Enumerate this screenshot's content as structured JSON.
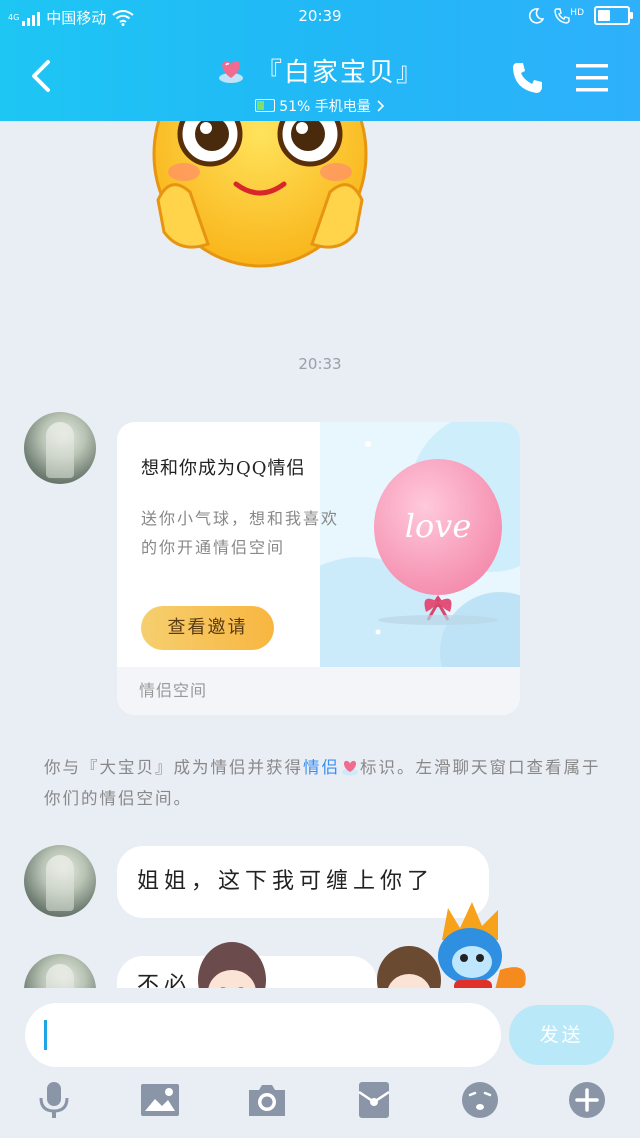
{
  "status_bar": {
    "network_type": "4G",
    "carrier": "中国移动",
    "time": "20:39",
    "call_label": "HD"
  },
  "header": {
    "title": "『白家宝贝』",
    "battery_text": "51% 手机电量",
    "battery_level_percent": 51,
    "gradient_colors": [
      "#1ec6f4",
      "#2eb0fb"
    ]
  },
  "chat": {
    "time_separator": "20:33",
    "invite_card": {
      "title": "想和你成为QQ情侣",
      "description": "送你小气球，想和我喜欢的你开通情侣空间",
      "button_label": "查看邀请",
      "balloon_text": "love",
      "footer": "情侣空间"
    },
    "system_message": {
      "prefix": "你与『大宝贝』成为情侣并获得",
      "link": "情侣",
      "suffix": "标识。左滑聊天窗口查看属于你们的情侣空间。"
    },
    "messages": [
      {
        "text": "姐姐，这下我可缠上你了"
      },
      {
        "text": "不必"
      }
    ]
  },
  "input_bar": {
    "send_label": "发送",
    "accent_color": "#1fa5e6"
  },
  "toolbar": {
    "icons": [
      "microphone-icon",
      "image-icon",
      "camera-icon",
      "red-packet-icon",
      "emoji-icon",
      "plus-icon"
    ]
  }
}
